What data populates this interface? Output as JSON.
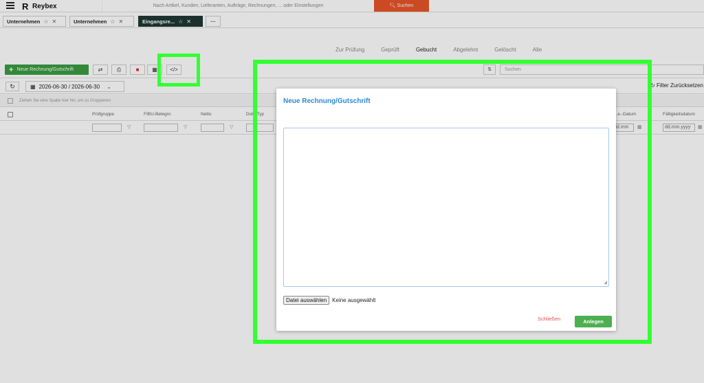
{
  "topbar": {
    "logo_text": "Reybex",
    "search_placeholder": "Nach Artikel, Kunden, Lieferanten, Aufträge, Rechnungen, ... oder Einstellungen",
    "search_button": "Suchen"
  },
  "tabs": [
    {
      "label": "Unternehmen"
    },
    {
      "label": "Unternehmen"
    },
    {
      "label": "Eingangsre..."
    }
  ],
  "tabs_more": "···",
  "status_tabs": [
    "Zur Prüfung",
    "Geprüft",
    "Gebucht",
    "Abgelehnt",
    "Gelöscht",
    "Alle"
  ],
  "toolbar": {
    "new_invoice": "Neue Rechnung/Gutschrift",
    "search_placeholder": "Suchen"
  },
  "date_range": "2026-06-30 / 2026-06-30",
  "filter_reset": "Filter Zurücksetzen",
  "group_hint": "Ziehen Sie eine Spalte hier hin, um zu Gruppieren",
  "columns": {
    "pruefgruppe": "Prüfgruppe",
    "fibu": "FIBU-Belegnr.",
    "netto": "Netto",
    "doctype": "Dok.-Typ",
    "datum": "...e.-Datum",
    "faellig": "Fälligkeitsdatum"
  },
  "filters": {
    "date_placeholder_a": "dd.mm",
    "date_placeholder_b": "dd.mm.yyyy"
  },
  "modal": {
    "title": "Neue Rechnung/Gutschrift",
    "file_button": "Datei auswählen",
    "file_none": "Keine ausgewählt",
    "close": "Schließen",
    "create": "Anlegen"
  },
  "colors": {
    "accent_green": "#3b9c43",
    "search_orange": "#e8552a",
    "modal_title_blue": "#2b8ad6",
    "highlight": "#33ff33"
  }
}
